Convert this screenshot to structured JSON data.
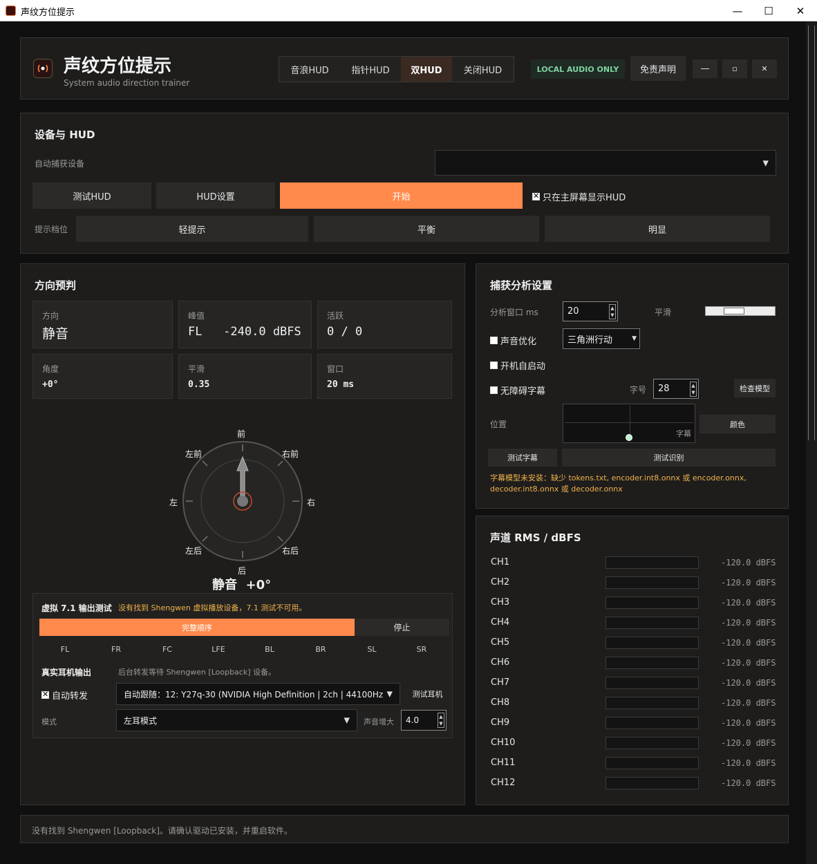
{
  "window": {
    "title": "声纹方位提示",
    "min": "—",
    "max": "☐",
    "close": "✕"
  },
  "header": {
    "app_title": "声纹方位提示",
    "subtitle": "System audio direction trainer",
    "tabs": [
      {
        "label": "音浪HUD"
      },
      {
        "label": "指针HUD"
      },
      {
        "label": "双HUD"
      },
      {
        "label": "关闭HUD"
      }
    ],
    "local_badge": "LOCAL AUDIO ONLY",
    "disclaimer": "免责声明",
    "min": "—",
    "max": "▫",
    "close": "✕"
  },
  "device": {
    "section_title": "设备与 HUD",
    "auto_capture_label": "自动捕获设备",
    "device_value": "",
    "test_hud": "测试HUD",
    "hud_settings": "HUD设置",
    "start": "开始",
    "main_screen_only": "只在主屏幕显示HUD",
    "hint_level_label": "提示档位",
    "levels": [
      "轻提示",
      "平衡",
      "明显"
    ]
  },
  "direction": {
    "section_title": "方向预判",
    "cards": [
      {
        "key": "方向",
        "value": "静音"
      },
      {
        "key": "峰值",
        "value": "FL   -240.0 dBFS"
      },
      {
        "key": "活跃",
        "value": "0 / 0"
      },
      {
        "key": "角度",
        "value": "+0°"
      },
      {
        "key": "平滑",
        "value": "0.35"
      },
      {
        "key": "窗口",
        "value": "20 ms"
      }
    ],
    "compass": {
      "front": "前",
      "front_right": "右前",
      "right": "右",
      "back_right": "右后",
      "back": "后",
      "back_left": "左后",
      "left": "左",
      "front_left": "左前"
    },
    "readout": "静音  +0°"
  },
  "virtual": {
    "title": "虚拟 7.1 输出测试",
    "warning": "没有找到 Shengwen 虚拟播放设备，7.1 测试不可用。",
    "full_order": "完整顺序",
    "stop": "停止",
    "channels": [
      "FL",
      "FR",
      "FC",
      "LFE",
      "BL",
      "BR",
      "SL",
      "SR"
    ],
    "real_title": "真实耳机输出",
    "real_hint": "后台转发等待 Shengwen [Loopback] 设备。",
    "auto_forward": "自动转发",
    "device": "自动跟随：12: Y27q-30 (NVIDIA High Definition | 2ch | 44100Hz",
    "test_headphone": "测试耳机",
    "mode_label": "模式",
    "mode_value": "左耳模式",
    "boost_label": "声音增大",
    "boost_value": "4.0"
  },
  "capture": {
    "section_title": "捕获分析设置",
    "window_label": "分析窗口 ms",
    "window_value": "20",
    "smooth_label": "平滑",
    "sound_opt": "声音优化",
    "game_value": "三角洲行动",
    "autostart": "开机自启动",
    "subtitles": "无障碍字幕",
    "font_label": "字号",
    "font_value": "28",
    "check_model": "检查模型",
    "position_label": "位置",
    "subtitle_tag": "字幕",
    "color": "颜色",
    "test_subtitle": "测试字幕",
    "test_recognize": "测试识别",
    "model_warning_1": "字幕模型未安装：缺少 tokens.txt, encoder.int8.onnx 或 encoder.onnx,",
    "model_warning_2": "decoder.int8.onnx 或 decoder.onnx"
  },
  "rms": {
    "section_title": "声道 RMS / dBFS",
    "channels": [
      {
        "name": "CH1",
        "db": "-120.0 dBFS"
      },
      {
        "name": "CH2",
        "db": "-120.0 dBFS"
      },
      {
        "name": "CH3",
        "db": "-120.0 dBFS"
      },
      {
        "name": "CH4",
        "db": "-120.0 dBFS"
      },
      {
        "name": "CH5",
        "db": "-120.0 dBFS"
      },
      {
        "name": "CH6",
        "db": "-120.0 dBFS"
      },
      {
        "name": "CH7",
        "db": "-120.0 dBFS"
      },
      {
        "name": "CH8",
        "db": "-120.0 dBFS"
      },
      {
        "name": "CH9",
        "db": "-120.0 dBFS"
      },
      {
        "name": "CH10",
        "db": "-120.0 dBFS"
      },
      {
        "name": "CH11",
        "db": "-120.0 dBFS"
      },
      {
        "name": "CH12",
        "db": "-120.0 dBFS"
      }
    ]
  },
  "status": {
    "message": "没有找到 Shengwen [Loopback]。请确认驱动已安装，并重启软件。"
  },
  "colors": {
    "accent": "#ff8a4c",
    "warning": "#f0b24a",
    "badge": "#7fd3a0"
  }
}
